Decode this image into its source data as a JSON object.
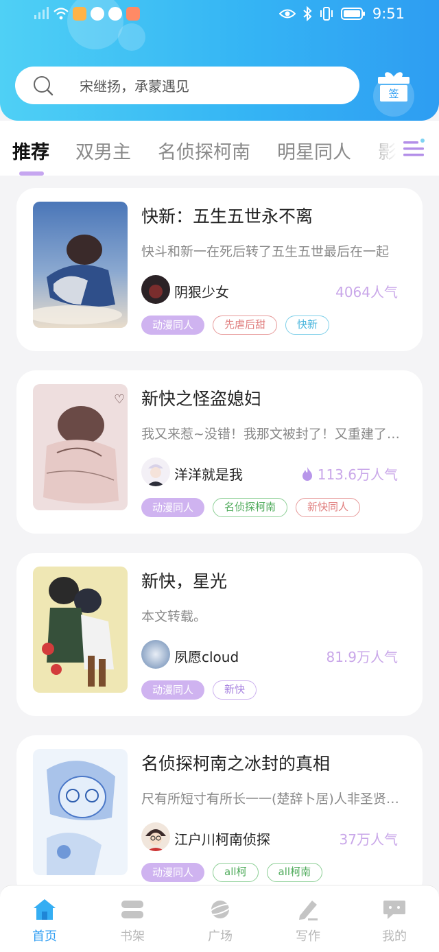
{
  "status_bar": {
    "time": "9:51"
  },
  "search": {
    "placeholder": "宋继扬，承蒙遇见"
  },
  "gift": {
    "label": "签"
  },
  "tabs": [
    {
      "label": "推荐",
      "active": true
    },
    {
      "label": "双男主",
      "active": false
    },
    {
      "label": "名侦探柯南",
      "active": false
    },
    {
      "label": "明星同人",
      "active": false
    },
    {
      "label": "影视",
      "active": false
    }
  ],
  "books": [
    {
      "title": "快新：五生五世永不离",
      "desc": "快斗和新一在死后转了五生五世最后在一起",
      "author": "阴狠少女",
      "popularity": "4064人气",
      "hot": false,
      "tags": [
        {
          "label": "动漫同人",
          "style": "solid"
        },
        {
          "label": "先虐后甜",
          "style": "red"
        },
        {
          "label": "快新",
          "style": "cyan"
        }
      ]
    },
    {
      "title": "新快之怪盗媳妇",
      "desc": "我又来惹~没错！我那文被封了！又重建了一个",
      "author": "洋洋就是我",
      "popularity": "113.6万人气",
      "hot": true,
      "tags": [
        {
          "label": "动漫同人",
          "style": "solid"
        },
        {
          "label": "名侦探柯南",
          "style": "green"
        },
        {
          "label": "新快同人",
          "style": "red"
        }
      ]
    },
    {
      "title": "新快，星光",
      "desc": "本文转载。",
      "author": "夙愿cloud",
      "popularity": "81.9万人气",
      "hot": false,
      "tags": [
        {
          "label": "动漫同人",
          "style": "solid"
        },
        {
          "label": "新快",
          "style": "purple"
        }
      ]
    },
    {
      "title": "名侦探柯南之冰封的真相",
      "desc": "尺有所短寸有所长一一(楚辞卜居)人非圣贤孰能无过",
      "author": "江户川柯南侦探",
      "popularity": "37万人气",
      "hot": false,
      "tags": [
        {
          "label": "动漫同人",
          "style": "solid"
        },
        {
          "label": "all柯",
          "style": "green"
        },
        {
          "label": "all柯南",
          "style": "green"
        }
      ]
    }
  ],
  "bottom_nav": [
    {
      "label": "首页",
      "icon": "home-icon",
      "active": true
    },
    {
      "label": "书架",
      "icon": "bookshelf-icon",
      "active": false
    },
    {
      "label": "广场",
      "icon": "planet-icon",
      "active": false
    },
    {
      "label": "写作",
      "icon": "pen-icon",
      "active": false
    },
    {
      "label": "我的",
      "icon": "chat-bubble-icon",
      "active": false
    }
  ],
  "colors": {
    "accent": "#2e9df2",
    "tag_purple": "#cfb3f0",
    "popularity": "#c9a7e9"
  }
}
